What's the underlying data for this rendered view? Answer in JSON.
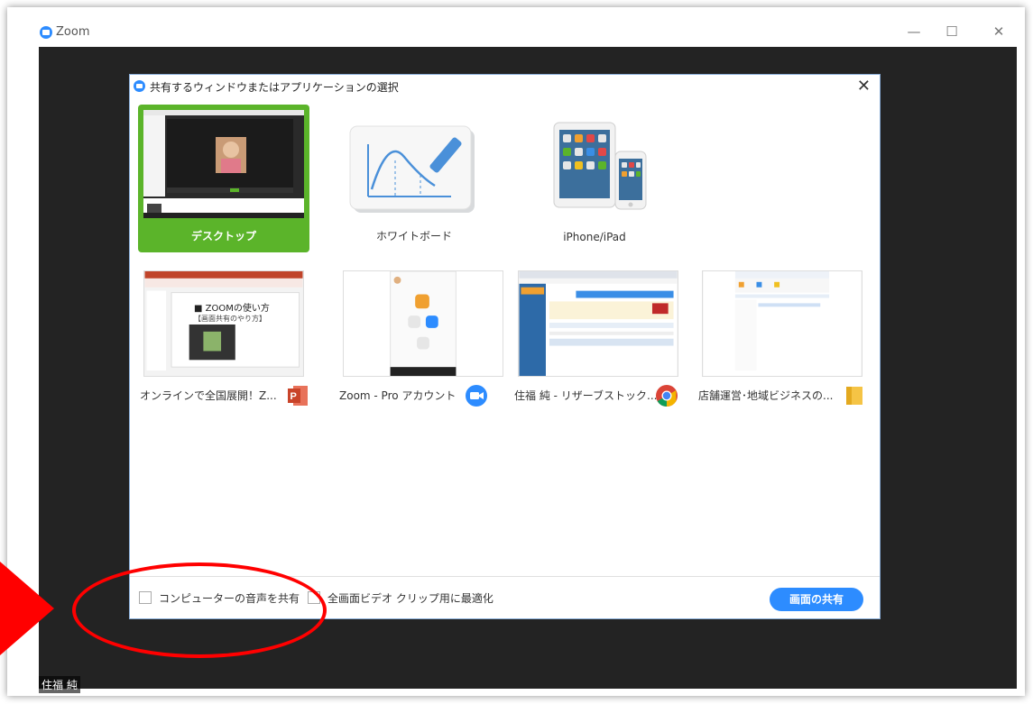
{
  "window": {
    "app_title": "Zoom",
    "minimize": "—",
    "maximize": "☐",
    "close": "✕"
  },
  "dialog": {
    "title": "共有するウィンドウまたはアプリケーションの選択",
    "close": "✕",
    "row1": [
      {
        "label": "デスクトップ",
        "selected": true
      },
      {
        "label": "ホワイトボード",
        "selected": false
      },
      {
        "label": "iPhone/iPad",
        "selected": false
      }
    ],
    "row2": [
      {
        "label": "オンラインで全国展開！Z...",
        "icon": "powerpoint-icon"
      },
      {
        "label": "Zoom - Pro アカウント",
        "icon": "zoom-icon"
      },
      {
        "label": "住福 純 - リザーブストック...",
        "icon": "chrome-icon"
      },
      {
        "label": "店舗運営･地域ビジネスの...",
        "icon": "folder-icon"
      }
    ],
    "ppt_slide": {
      "line1": "■ ZOOMの使い方",
      "line2": "【画面共有のやり方】"
    },
    "options": {
      "share_sound": "コンピューターの音声を共有",
      "optimize_video": "全画面ビデオ クリップ用に最適化"
    },
    "share_button": "画面の共有"
  },
  "participant_name": "住福 純",
  "colors": {
    "selected": "#5bb42a",
    "accent": "#2d8cff",
    "annotation": "#ff0000"
  }
}
